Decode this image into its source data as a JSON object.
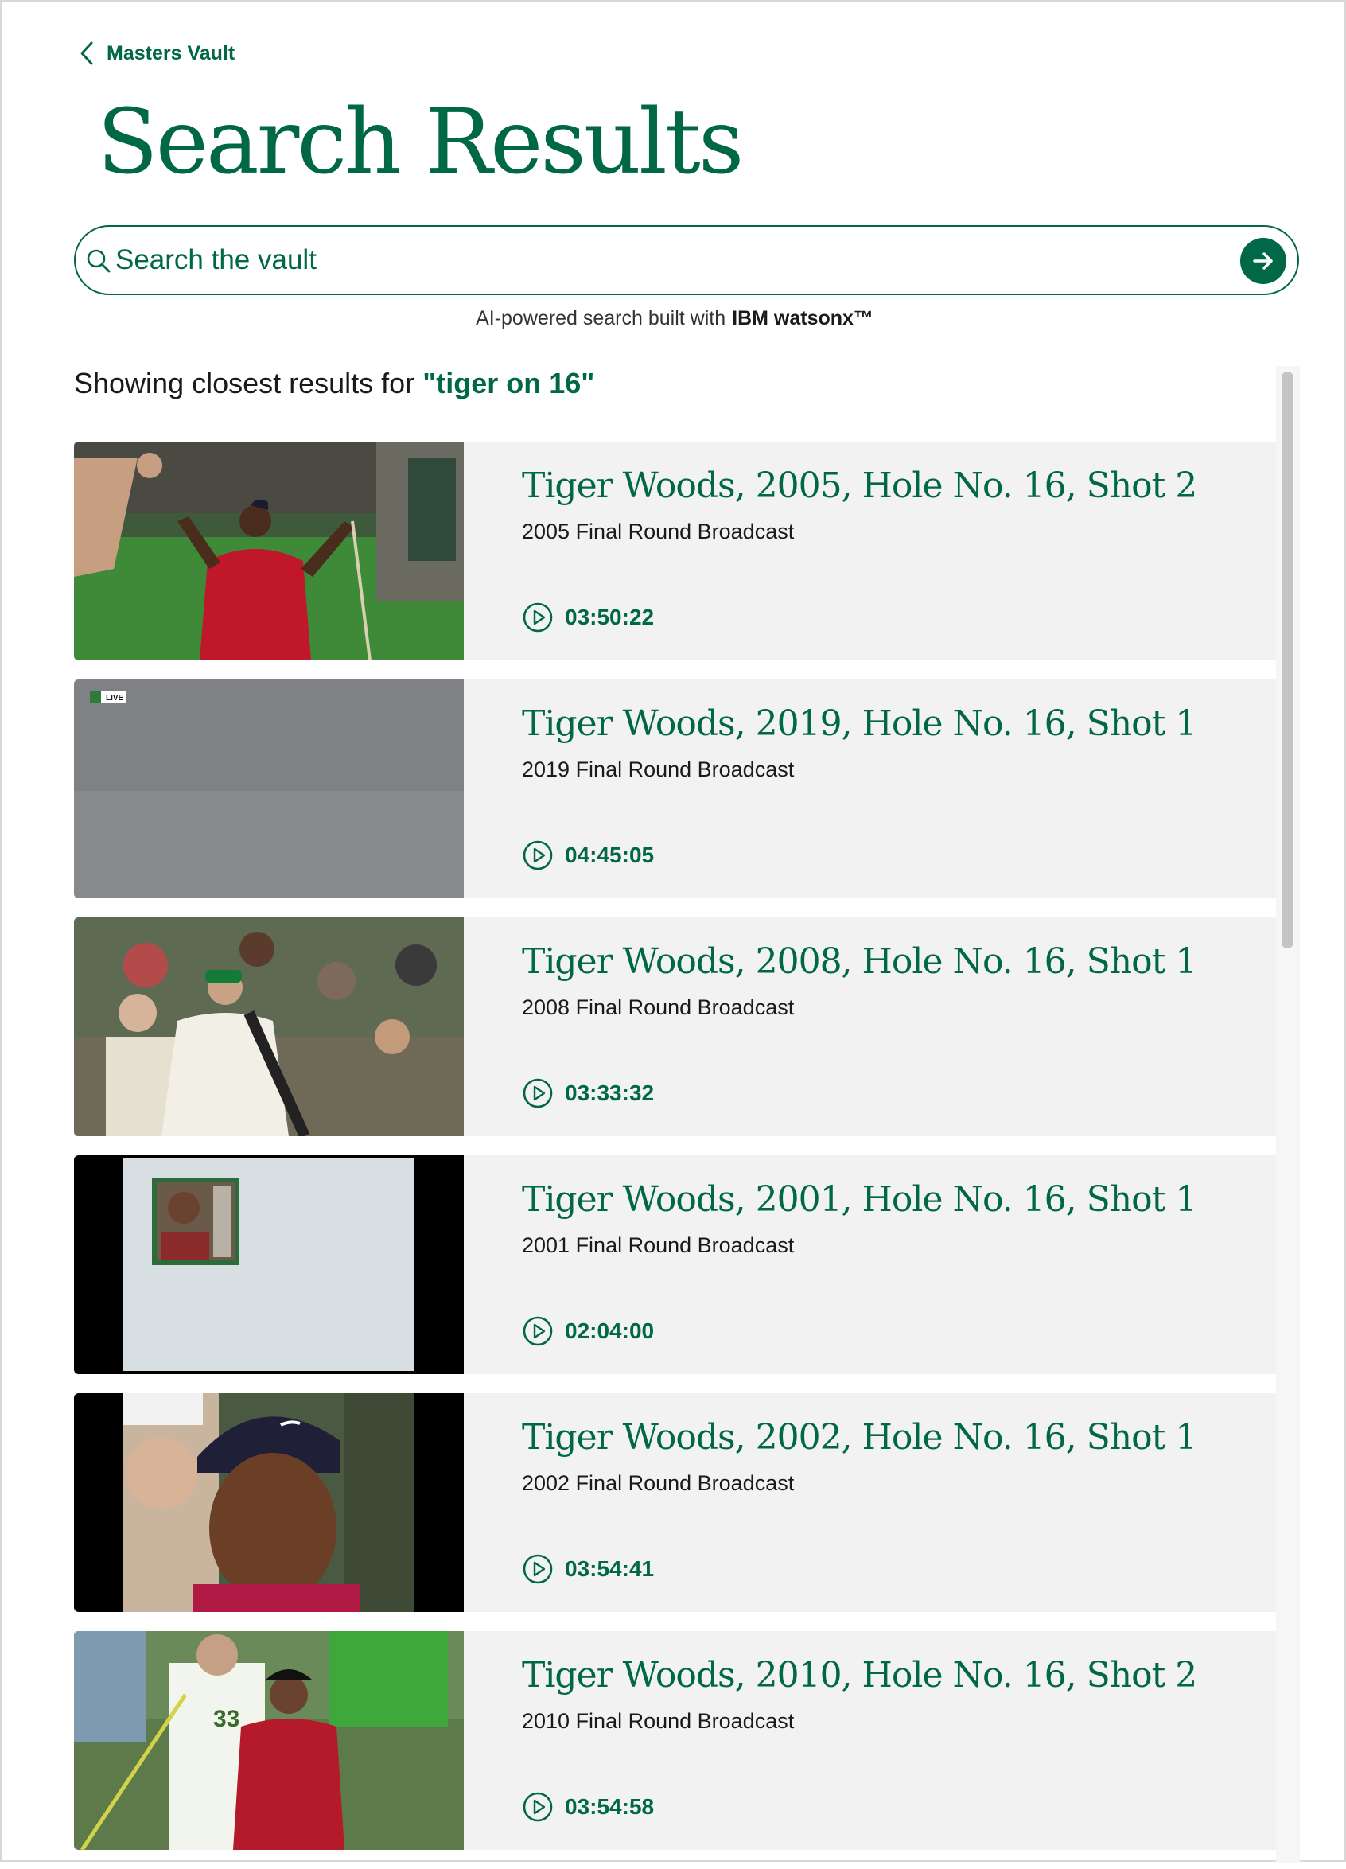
{
  "nav": {
    "back_label": "Masters Vault"
  },
  "page": {
    "title": "Search Results"
  },
  "search": {
    "placeholder": "Search the vault"
  },
  "powered_by": {
    "text": "AI-powered search built with",
    "brand": "IBM watsonx™"
  },
  "results_header": {
    "prefix": "Showing closest results for ",
    "query": "\"tiger on 16\""
  },
  "colors": {
    "accent": "#006747",
    "card_bg": "#f2f2f2"
  },
  "results": [
    {
      "title": "Tiger Woods, 2005, Hole No. 16, Shot 2",
      "subtitle": "2005 Final Round Broadcast",
      "duration": "03:50:22",
      "thumb": "celebration"
    },
    {
      "title": "Tiger Woods, 2019, Hole No. 16, Shot 1",
      "subtitle": "2019 Final Round Broadcast",
      "duration": "04:45:05",
      "thumb": "sky-live",
      "thumb_badge": "LIVE"
    },
    {
      "title": "Tiger Woods, 2008, Hole No. 16, Shot 1",
      "subtitle": "2008 Final Round Broadcast",
      "duration": "03:33:32",
      "thumb": "crowd-caddie"
    },
    {
      "title": "Tiger Woods, 2001, Hole No. 16, Shot 1",
      "subtitle": "2001 Final Round Broadcast",
      "duration": "02:04:00",
      "thumb": "sky-inset"
    },
    {
      "title": "Tiger Woods, 2002, Hole No. 16, Shot 1",
      "subtitle": "2002 Final Round Broadcast",
      "duration": "03:54:41",
      "thumb": "closeup"
    },
    {
      "title": "Tiger Woods, 2010, Hole No. 16, Shot 2",
      "subtitle": "2010 Final Round Broadcast",
      "duration": "03:54:58",
      "thumb": "walking"
    }
  ]
}
